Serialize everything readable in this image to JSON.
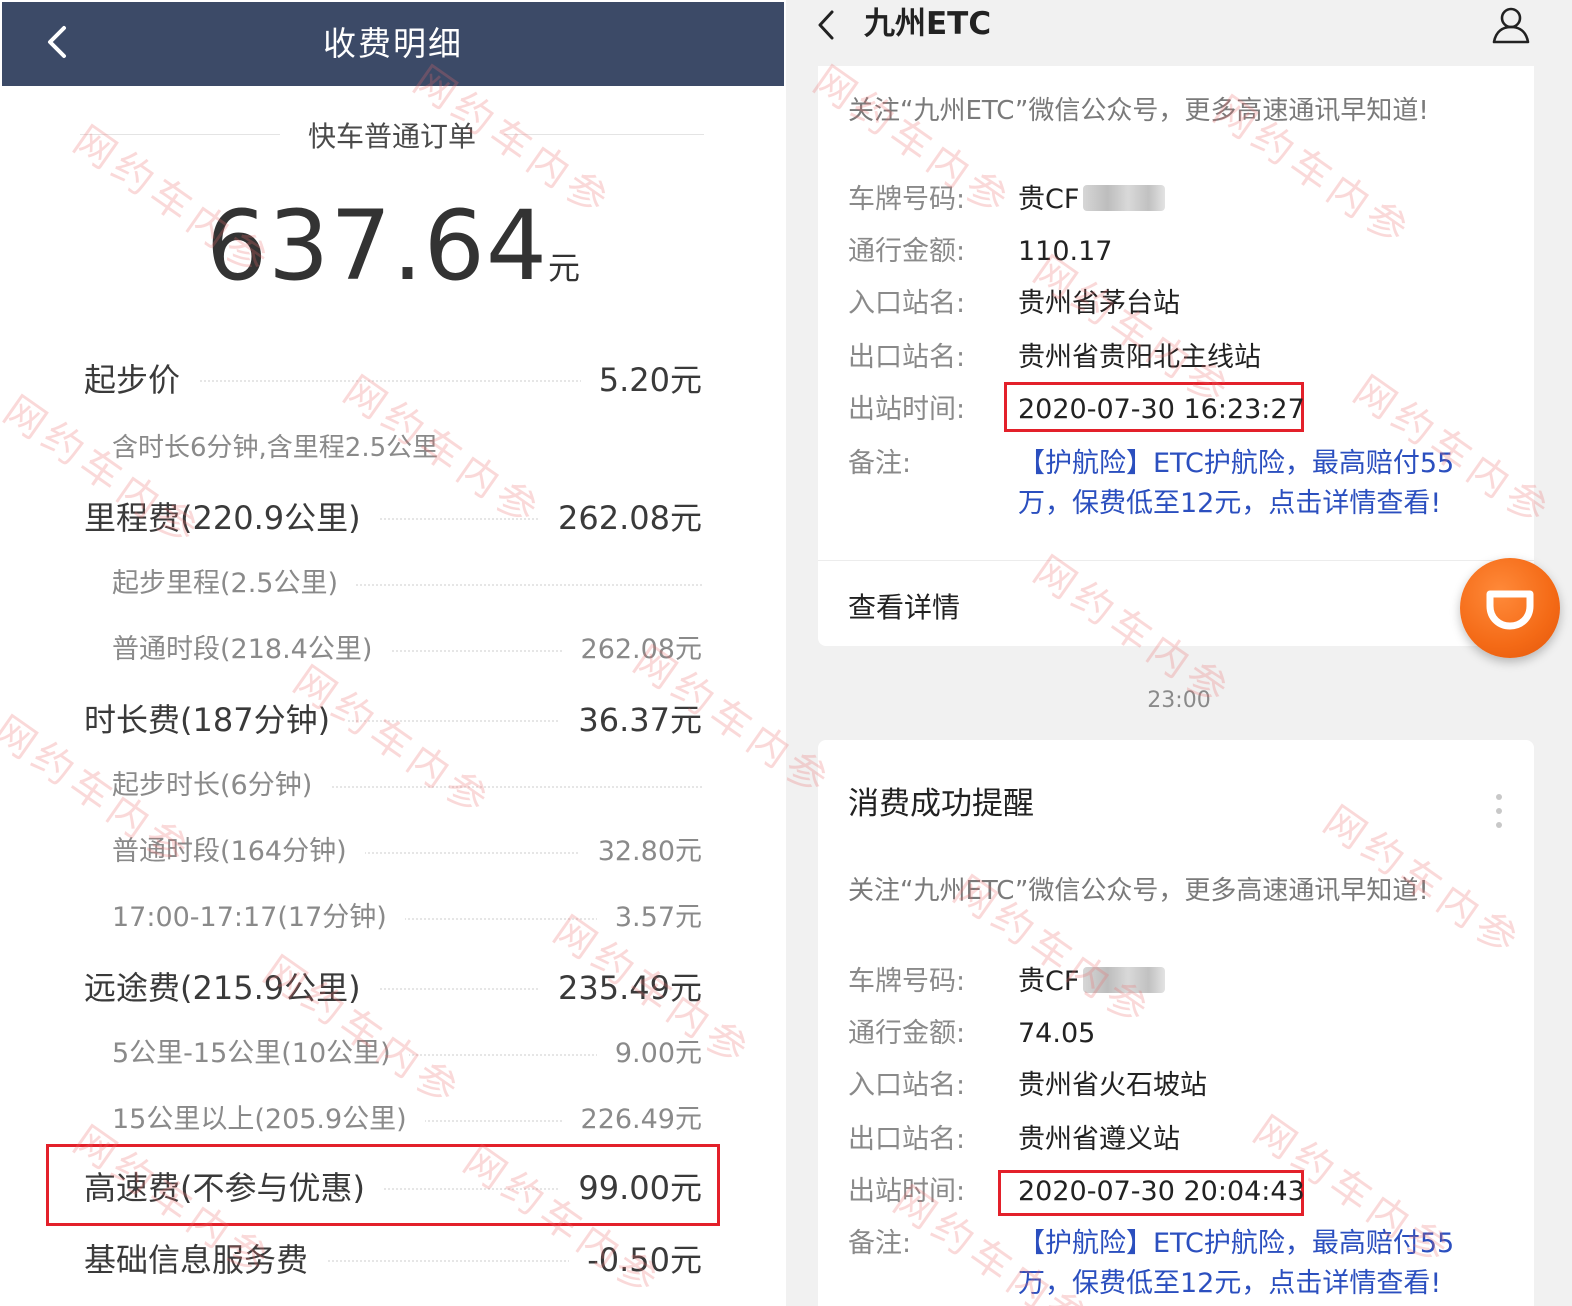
{
  "left": {
    "header": {
      "title": "收费明细",
      "back_icon": "chevron-left-icon"
    },
    "order_type": "快车普通订单",
    "total": {
      "amount": "637.64",
      "unit": "元"
    },
    "fees": {
      "base": {
        "label": "起步价",
        "value": "5.20元",
        "note": "含时长6分钟,含里程2.5公里"
      },
      "mileage": {
        "label": "里程费(220.9公里)",
        "value": "262.08元",
        "items": [
          {
            "label": "起步里程(2.5公里)",
            "value": ""
          },
          {
            "label": "普通时段(218.4公里)",
            "value": "262.08元"
          }
        ]
      },
      "duration": {
        "label": "时长费(187分钟)",
        "value": "36.37元",
        "items": [
          {
            "label": "起步时长(6分钟)",
            "value": ""
          },
          {
            "label": "普通时段(164分钟)",
            "value": "32.80元"
          },
          {
            "label": "17:00-17:17(17分钟)",
            "value": "3.57元"
          }
        ]
      },
      "long_distance": {
        "label": "远途费(215.9公里)",
        "value": "235.49元",
        "items": [
          {
            "label": "5公里-15公里(10公里)",
            "value": "9.00元"
          },
          {
            "label": "15公里以上(205.9公里)",
            "value": "226.49元"
          }
        ]
      },
      "highway": {
        "label": "高速费(不参与优惠)",
        "value": "99.00元"
      },
      "info_service": {
        "label": "基础信息服务费",
        "value": "-0.50元"
      }
    }
  },
  "right": {
    "header": {
      "title": "九州ETC",
      "back_icon": "chevron-left-icon",
      "user_icon": "user-icon"
    },
    "card1": {
      "notice": "关注“九州ETC”微信公众号，更多高速通讯早知道!",
      "plate_label": "车牌号码:",
      "plate_value": "贵CF",
      "amount_label": "通行金额:",
      "amount_value": "110.17",
      "entry_label": "入口站名:",
      "entry_value": "贵州省茅台站",
      "exit_label": "出口站名:",
      "exit_value": "贵州省贵阳北主线站",
      "time_label": "出站时间:",
      "time_value": "2020-07-30 16:23:27",
      "remark_label": "备注:",
      "remark_value": "【护航险】ETC护航险，最高赔付55万，保费低至12元，点击详情查看!",
      "detail": "查看详情"
    },
    "timestamp": "23:00",
    "card2": {
      "title": "消费成功提醒",
      "notice": "关注“九州ETC”微信公众号，更多高速通讯早知道!",
      "plate_label": "车牌号码:",
      "plate_value": "贵CF",
      "amount_label": "通行金额:",
      "amount_value": "74.05",
      "entry_label": "入口站名:",
      "entry_value": "贵州省火石坡站",
      "exit_label": "出口站名:",
      "exit_value": "贵州省遵义站",
      "time_label": "出站时间:",
      "time_value": "2020-07-30 20:04:43",
      "remark_label": "备注:",
      "remark_value": "【护航险】ETC护航险，最高赔付55万，保费低至12元，点击详情查看!"
    },
    "fab_icon": "didi-logo-icon"
  },
  "watermark": "网约车内参",
  "colors": {
    "header_bg": "#3c4a67",
    "highlight": "#e3202a",
    "link": "#2b4fbf",
    "fab": "#f46a16"
  }
}
